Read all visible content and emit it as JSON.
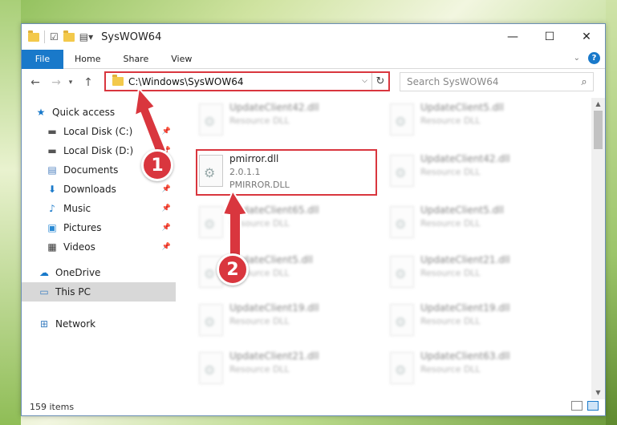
{
  "window": {
    "title": "SysWOW64",
    "controls": {
      "minimize": "—",
      "maximize": "☐",
      "close": "✕"
    }
  },
  "ribbon": {
    "tabs": [
      "File",
      "Home",
      "Share",
      "View"
    ],
    "help": "?"
  },
  "address": {
    "path": "C:\\Windows\\SysWOW64",
    "search_placeholder": "Search SysWOW64"
  },
  "nav": {
    "items": [
      {
        "label": "Quick access",
        "icon": "star-icon"
      },
      {
        "label": "Local Disk (C:)",
        "icon": "drive-icon",
        "pinned": true
      },
      {
        "label": "Local Disk (D:)",
        "icon": "drive-icon",
        "pinned": true
      },
      {
        "label": "Documents",
        "icon": "documents-icon",
        "pinned": true
      },
      {
        "label": "Downloads",
        "icon": "downloads-icon",
        "pinned": true
      },
      {
        "label": "Music",
        "icon": "music-icon",
        "pinned": true
      },
      {
        "label": "Pictures",
        "icon": "pictures-icon",
        "pinned": true
      },
      {
        "label": "Videos",
        "icon": "videos-icon",
        "pinned": true
      },
      {
        "label": "OneDrive",
        "icon": "cloud-icon"
      },
      {
        "label": "This PC",
        "icon": "computer-icon",
        "selected": true
      },
      {
        "label": "Network",
        "icon": "network-icon"
      }
    ]
  },
  "files": {
    "highlighted": {
      "name": "pmirror.dll",
      "version": "2.0.1.1",
      "product": "PMIRROR.DLL"
    },
    "left_col": [
      {
        "name": "UpdateClient42.dll",
        "type": "Resource DLL"
      },
      {
        "name": "UpdateClient65.dll",
        "type": "Resource DLL"
      },
      {
        "name": "UpdateClient5.dll",
        "type": "Resource DLL"
      },
      {
        "name": "UpdateClient19.dll",
        "type": "Resource DLL"
      },
      {
        "name": "UpdateClient21.dll",
        "type": "Resource DLL"
      }
    ],
    "right_col": [
      {
        "name": "UpdateClient5.dll",
        "type": "Resource DLL"
      },
      {
        "name": "UpdateClient42.dll",
        "type": "Resource DLL"
      },
      {
        "name": "UpdateClient5.dll",
        "type": "Resource DLL"
      },
      {
        "name": "UpdateClient21.dll",
        "type": "Resource DLL"
      },
      {
        "name": "UpdateClient19.dll",
        "type": "Resource DLL"
      },
      {
        "name": "UpdateClient63.dll",
        "type": "Resource DLL"
      }
    ]
  },
  "status": {
    "count": "159 items"
  },
  "callouts": {
    "one": "1",
    "two": "2"
  },
  "colors": {
    "accent": "#1979ca",
    "highlight": "#d9363e"
  }
}
